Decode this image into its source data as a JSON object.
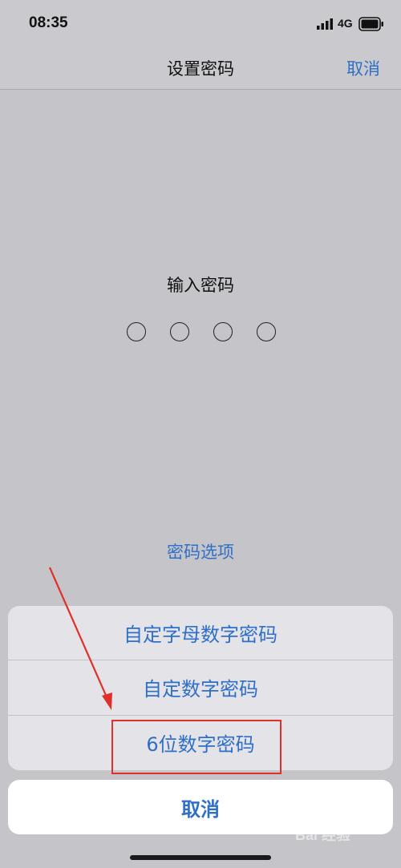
{
  "status_bar": {
    "time": "08:35",
    "network": "4G",
    "signal_icon": "cellular-signal-icon",
    "battery_icon": "battery-icon"
  },
  "nav": {
    "title": "设置密码",
    "cancel_label": "取消"
  },
  "passcode": {
    "prompt": "输入密码",
    "digit_count": 4,
    "options_label": "密码选项"
  },
  "action_sheet": {
    "items": [
      {
        "label": "自定字母数字密码"
      },
      {
        "label": "自定数字密码"
      },
      {
        "label": "6位数字密码"
      }
    ],
    "cancel_label": "取消"
  },
  "annotation": {
    "color": "#e0302a",
    "highlighted_item": "6位数字密码"
  },
  "watermark": {
    "text": "Bai 经验"
  },
  "colors": {
    "accent": "#2f6fc6",
    "background": "#c4c4c9",
    "sheet_background": "#e4e4e8"
  }
}
